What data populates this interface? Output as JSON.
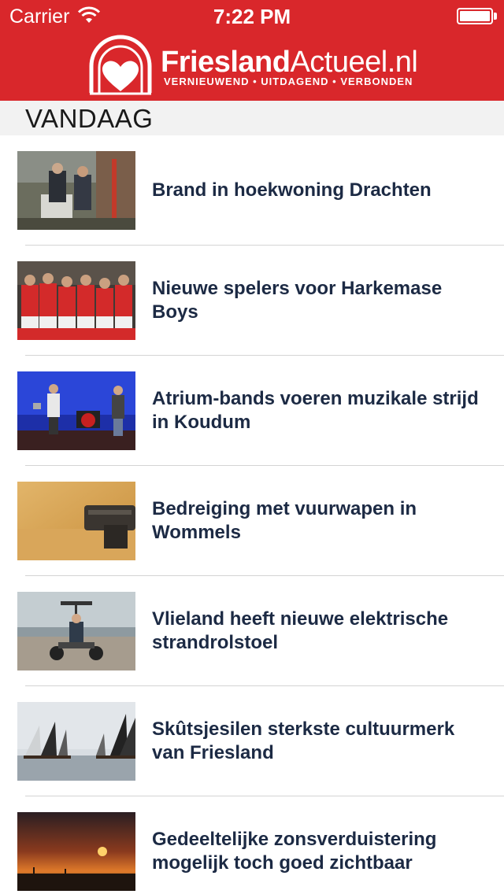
{
  "status_bar": {
    "carrier": "Carrier",
    "time": "7:22 PM"
  },
  "header": {
    "brand_bold": "Friesland",
    "brand_light": "Actueel.nl",
    "tagline": "VERNIEUWEND • UITDAGEND • VERBONDEN",
    "accent_color": "#d9272b"
  },
  "section": {
    "title": "VANDAAG"
  },
  "articles": [
    {
      "title": "Brand in hoekwoning Drachten",
      "thumbnail": "firefighters-photo"
    },
    {
      "title": "Nieuwe spelers voor Harkemase Boys",
      "thumbnail": "football-team-photo"
    },
    {
      "title": "Atrium-bands voeren muzikale strijd in Koudum",
      "thumbnail": "band-stage-photo"
    },
    {
      "title": "Bedreiging met vuurwapen in Wommels",
      "thumbnail": "handgun-photo"
    },
    {
      "title": "Vlieland heeft nieuwe elektrische strandrolstoel",
      "thumbnail": "beach-wheelchair-photo"
    },
    {
      "title": "Skûtsjesilen sterkste cultuurmerk van Friesland",
      "thumbnail": "sailing-boats-photo"
    },
    {
      "title": "Gedeeltelijke zonsverduistering mogelijk toch goed zichtbaar",
      "thumbnail": "sunset-eclipse-photo"
    }
  ]
}
